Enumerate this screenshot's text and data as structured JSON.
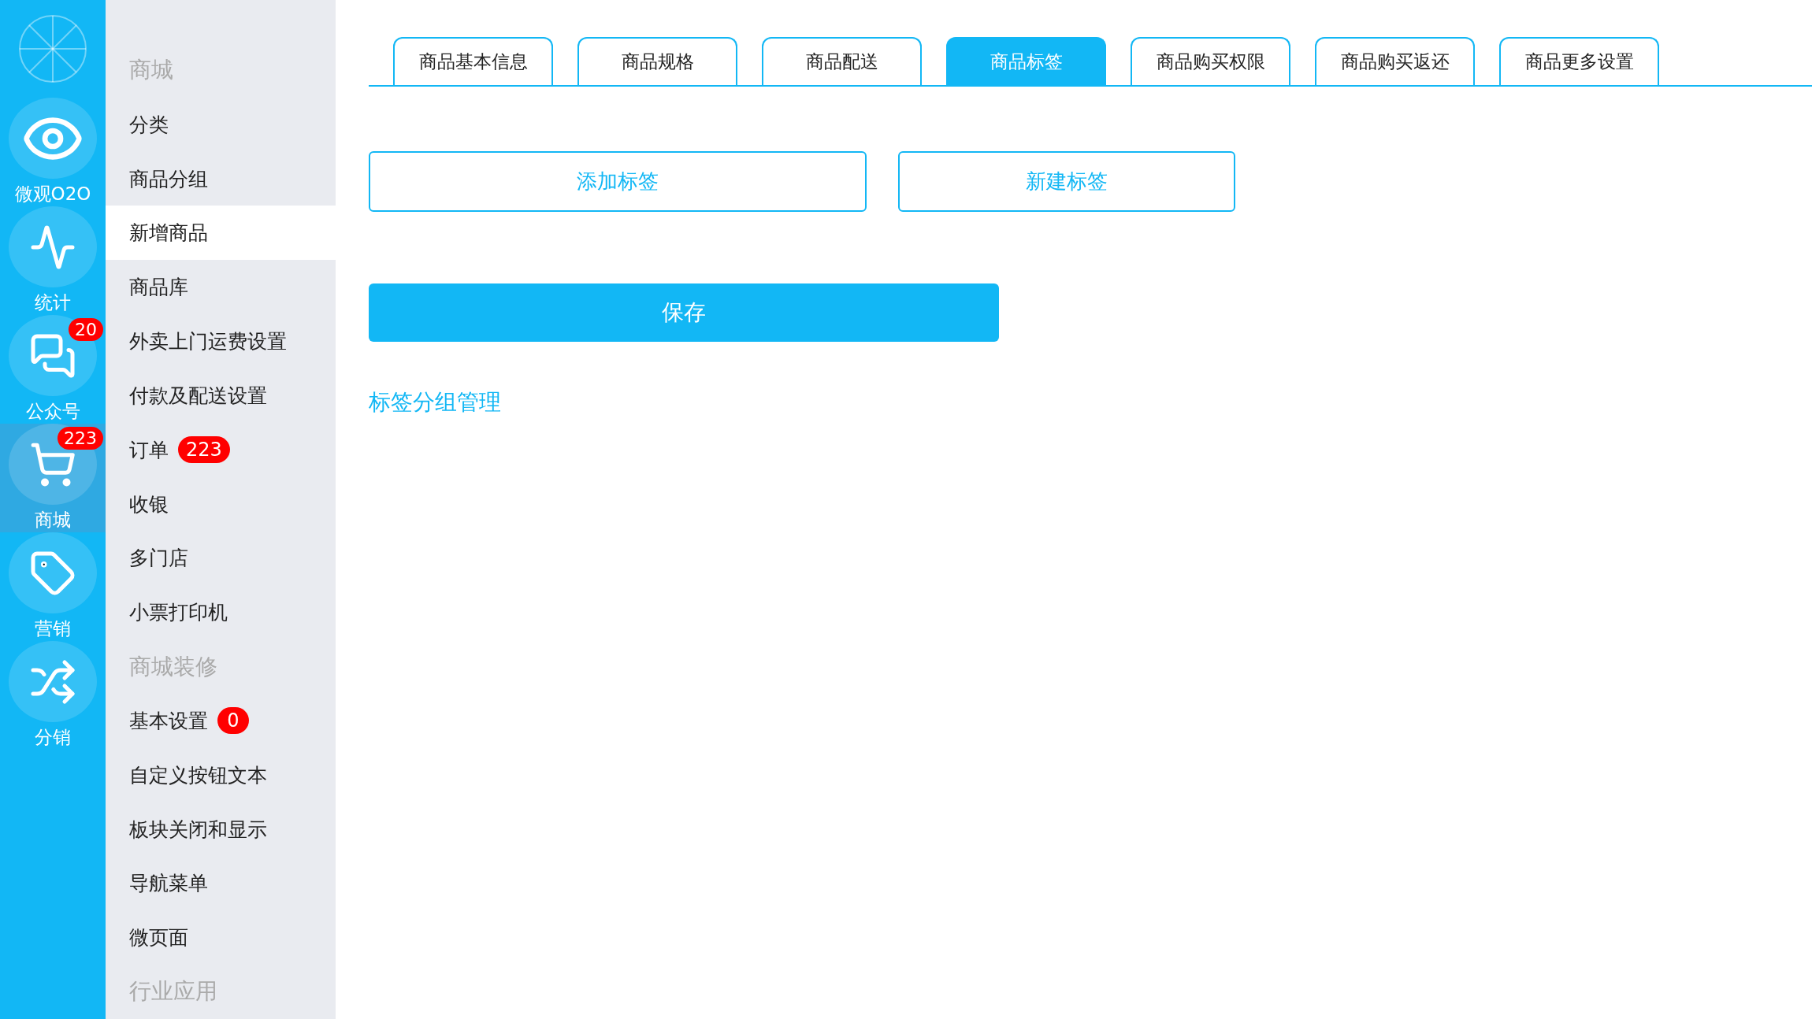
{
  "rail": {
    "items": [
      {
        "kind": "eye",
        "label": "微观O2O",
        "selected": false
      },
      {
        "kind": "pulse",
        "label": "统计",
        "selected": false
      },
      {
        "kind": "chat",
        "label": "公众号",
        "badge": "20",
        "selected": false
      },
      {
        "kind": "cart",
        "label": "商城",
        "badge": "223",
        "selected": true
      },
      {
        "kind": "tag",
        "label": "营销",
        "selected": false
      },
      {
        "kind": "shuffle",
        "label": "分销",
        "selected": false
      }
    ]
  },
  "sidebar": {
    "items": [
      {
        "kind": "header",
        "label": "商城"
      },
      {
        "kind": "item",
        "label": "分类",
        "selected": false
      },
      {
        "kind": "item",
        "label": "商品分组",
        "selected": false
      },
      {
        "kind": "item",
        "label": "新增商品",
        "selected": true
      },
      {
        "kind": "item",
        "label": "商品库",
        "selected": false
      },
      {
        "kind": "item",
        "label": "外卖上门运费设置",
        "selected": false
      },
      {
        "kind": "item",
        "label": "付款及配送设置",
        "selected": false
      },
      {
        "kind": "item",
        "label": "订单",
        "selected": false,
        "badge": "223"
      },
      {
        "kind": "item",
        "label": "收银",
        "selected": false
      },
      {
        "kind": "item",
        "label": "多门店",
        "selected": false
      },
      {
        "kind": "item",
        "label": "小票打印机",
        "selected": false
      },
      {
        "kind": "header",
        "label": "商城装修"
      },
      {
        "kind": "item",
        "label": "基本设置",
        "selected": false,
        "badge": "0"
      },
      {
        "kind": "item",
        "label": "自定义按钮文本",
        "selected": false
      },
      {
        "kind": "item",
        "label": "板块关闭和显示",
        "selected": false
      },
      {
        "kind": "item",
        "label": "导航菜单",
        "selected": false
      },
      {
        "kind": "item",
        "label": "微页面",
        "selected": false
      },
      {
        "kind": "header",
        "label": "行业应用"
      }
    ]
  },
  "tabs": [
    {
      "label": "商品基本信息",
      "selected": false
    },
    {
      "label": "商品规格",
      "selected": false
    },
    {
      "label": "商品配送",
      "selected": false
    },
    {
      "label": "商品标签",
      "selected": true
    },
    {
      "label": "商品购买权限",
      "selected": false
    },
    {
      "label": "商品购买返还",
      "selected": false
    },
    {
      "label": "商品更多设置",
      "selected": false
    }
  ],
  "tag_buttons": [
    "添加标签",
    "新建标签"
  ],
  "save_button": "保存",
  "link": "标签分组管理"
}
